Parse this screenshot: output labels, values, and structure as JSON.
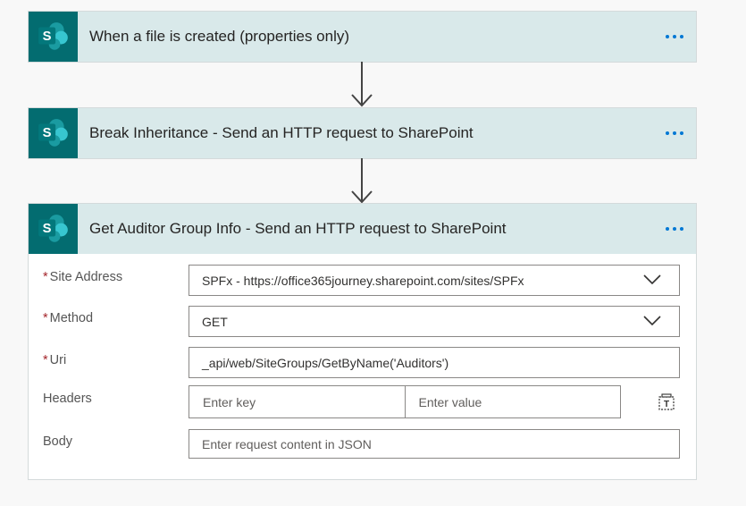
{
  "flow": {
    "steps": [
      {
        "title": "When a file is created (properties only)",
        "icon": "sharepoint-icon"
      },
      {
        "title": "Break Inheritance - Send an HTTP request to SharePoint",
        "icon": "sharepoint-icon"
      },
      {
        "title": "Get Auditor Group Info - Send an HTTP request to SharePoint",
        "icon": "sharepoint-icon"
      }
    ]
  },
  "form": {
    "required_mark": "*",
    "site_address": {
      "label": "Site Address",
      "value": "SPFx - https://office365journey.sharepoint.com/sites/SPFx"
    },
    "method": {
      "label": "Method",
      "value": "GET"
    },
    "uri": {
      "label": "Uri",
      "value": "_api/web/SiteGroups/GetByName('Auditors')"
    },
    "headers": {
      "label": "Headers",
      "key_placeholder": "Enter key",
      "value_placeholder": "Enter value"
    },
    "body": {
      "label": "Body",
      "placeholder": "Enter request content in JSON"
    }
  },
  "colors": {
    "header_bg": "#d9e9ea",
    "icon_bg": "#036c70",
    "accent": "#0078d4",
    "required": "#a4262c"
  }
}
